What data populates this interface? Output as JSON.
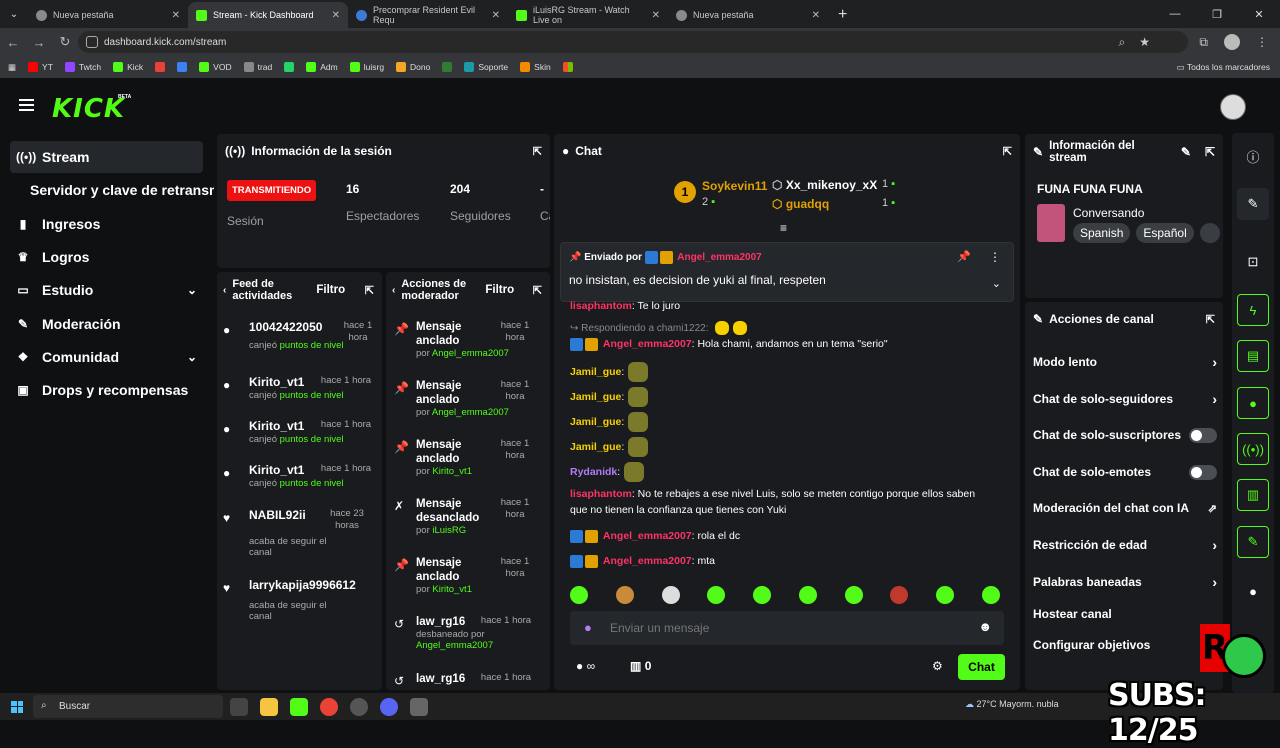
{
  "browser": {
    "tabs": [
      {
        "title": "Nueva pestaña"
      },
      {
        "title": "Stream - Kick Dashboard"
      },
      {
        "title": "Precomprar Resident Evil Requ"
      },
      {
        "title": "iLuisRG Stream - Watch Live on"
      },
      {
        "title": "Nueva pestaña"
      }
    ],
    "url": "dashboard.kick.com/stream",
    "bookmarks": [
      "YT",
      "Twtch",
      "Kick",
      "VOD",
      "trad",
      "Adm",
      "luisrg",
      "Dono",
      "Soporte",
      "Skin"
    ],
    "bookmarks_all": "Todos los marcadores"
  },
  "brand": {
    "logo": "KICK",
    "beta": "BETA"
  },
  "sidebar": {
    "items": [
      {
        "label": "Stream"
      },
      {
        "label": "Servidor y clave de retransm"
      },
      {
        "label": "Ingresos"
      },
      {
        "label": "Logros"
      },
      {
        "label": "Estudio"
      },
      {
        "label": "Moderación"
      },
      {
        "label": "Comunidad"
      },
      {
        "label": "Drops y recompensas"
      }
    ]
  },
  "session": {
    "title": "Información de la sesión",
    "status": "TRANSMITIENDO",
    "status_label": "Sesión",
    "viewers": "16",
    "viewers_label": "Espectadores",
    "followers": "204",
    "followers_label": "Seguidores",
    "extra": "-",
    "extra_label": "Ca"
  },
  "feed": {
    "title": "Feed de actividades",
    "filter": "Filtro",
    "items": [
      {
        "name": "10042422050",
        "time": "hace 1 hora",
        "sub": "canjeó ",
        "highlight": "puntos de nivel"
      },
      {
        "name": "Kirito_vt1",
        "time": "hace 1 hora",
        "sub": "canjeó ",
        "highlight": "puntos de nivel"
      },
      {
        "name": "Kirito_vt1",
        "time": "hace 1 hora",
        "sub": "canjeó ",
        "highlight": "puntos de nivel"
      },
      {
        "name": "Kirito_vt1",
        "time": "hace 1 hora",
        "sub": "canjeó ",
        "highlight": "puntos de nivel"
      },
      {
        "name": "NABIL92ii",
        "time": "hace 23 horas",
        "sub": "acaba de seguir el canal",
        "highlight": ""
      },
      {
        "name": "larrykapija9996612",
        "time": "",
        "sub": "acaba de seguir el canal",
        "highlight": ""
      }
    ]
  },
  "modactions": {
    "title": "Acciones de moderador",
    "filter": "Filtro",
    "items": [
      {
        "title": "Mensaje anclado",
        "by": "por ",
        "user": "Angel_emma2007",
        "time": "hace 1 hora"
      },
      {
        "title": "Mensaje anclado",
        "by": "por ",
        "user": "Angel_emma2007",
        "time": "hace 1 hora"
      },
      {
        "title": "Mensaje anclado",
        "by": "por ",
        "user": "Kirito_vt1",
        "time": "hace 1 hora"
      },
      {
        "title": "Mensaje desanclado",
        "by": "por ",
        "user": "iLuisRG",
        "time": "hace 1 hora"
      },
      {
        "title": "Mensaje anclado",
        "by": "por ",
        "user": "Kirito_vt1",
        "time": "hace 1 hora"
      },
      {
        "title": "law_rg16",
        "by": "desbaneado por ",
        "user": "Angel_emma2007",
        "time": "hace 1 hora"
      },
      {
        "title": "law_rg16",
        "by": "",
        "user": "",
        "time": "hace 1 hora"
      }
    ]
  },
  "chat": {
    "title": "Chat",
    "top": [
      {
        "rank": "1",
        "name": "Soykevin11",
        "count": "2"
      },
      {
        "name": "Xx_mikenoy_xX",
        "count": "1"
      },
      {
        "name": "guadqq",
        "count": "1"
      }
    ],
    "pinned": {
      "label": "Enviado por",
      "user": "Angel_emma2007",
      "text": "no insistan, es decision de yuki al final, respeten"
    },
    "messages": [
      {
        "user": "lisaphantom",
        "text": ": Te lo juro"
      },
      {
        "reply": "Respondiendo a chami1222:"
      },
      {
        "user": "Angel_emma2007",
        "text": ": Hola chami, andamos en un tema \"serio\""
      },
      {
        "user": "Jamil_gue",
        "text": ":"
      },
      {
        "user": "Jamil_gue",
        "text": ":"
      },
      {
        "user": "Jamil_gue",
        "text": ":"
      },
      {
        "user": "Jamil_gue",
        "text": ":"
      },
      {
        "user": "Rydanidk",
        "text": ":"
      },
      {
        "user": "lisaphantom",
        "text": ": No te rebajes a ese nivel Luis, solo se meten contigo porque ellos saben que no tienen la confianza que tienes con Yuki"
      },
      {
        "user": "Angel_emma2007",
        "text": ": rola el dc"
      },
      {
        "user": "Angel_emma2007",
        "text": ": mta"
      }
    ],
    "placeholder": "Enviar un mensaje",
    "points": "0",
    "send": "Chat"
  },
  "streaminfo": {
    "title": "Información del stream",
    "stream_title": "FUNA FUNA FUNA",
    "category": "Conversando",
    "tags": [
      "Spanish",
      "Español"
    ]
  },
  "channel": {
    "title": "Acciones de canal",
    "items": [
      {
        "label": "Modo lento"
      },
      {
        "label": "Chat de solo-seguidores"
      },
      {
        "label": "Chat de solo-suscriptores"
      },
      {
        "label": "Chat de solo-emotes"
      },
      {
        "label": "Moderación del chat con IA"
      },
      {
        "label": "Restricción de edad"
      },
      {
        "label": "Palabras baneadas"
      },
      {
        "label": "Hostear canal"
      },
      {
        "label": "Configurar objetivos"
      }
    ]
  },
  "taskbar": {
    "search": "Buscar",
    "weather": "27°C  Mayorm. nubla"
  },
  "overlay": {
    "subs": "SUBS: 12/25"
  }
}
